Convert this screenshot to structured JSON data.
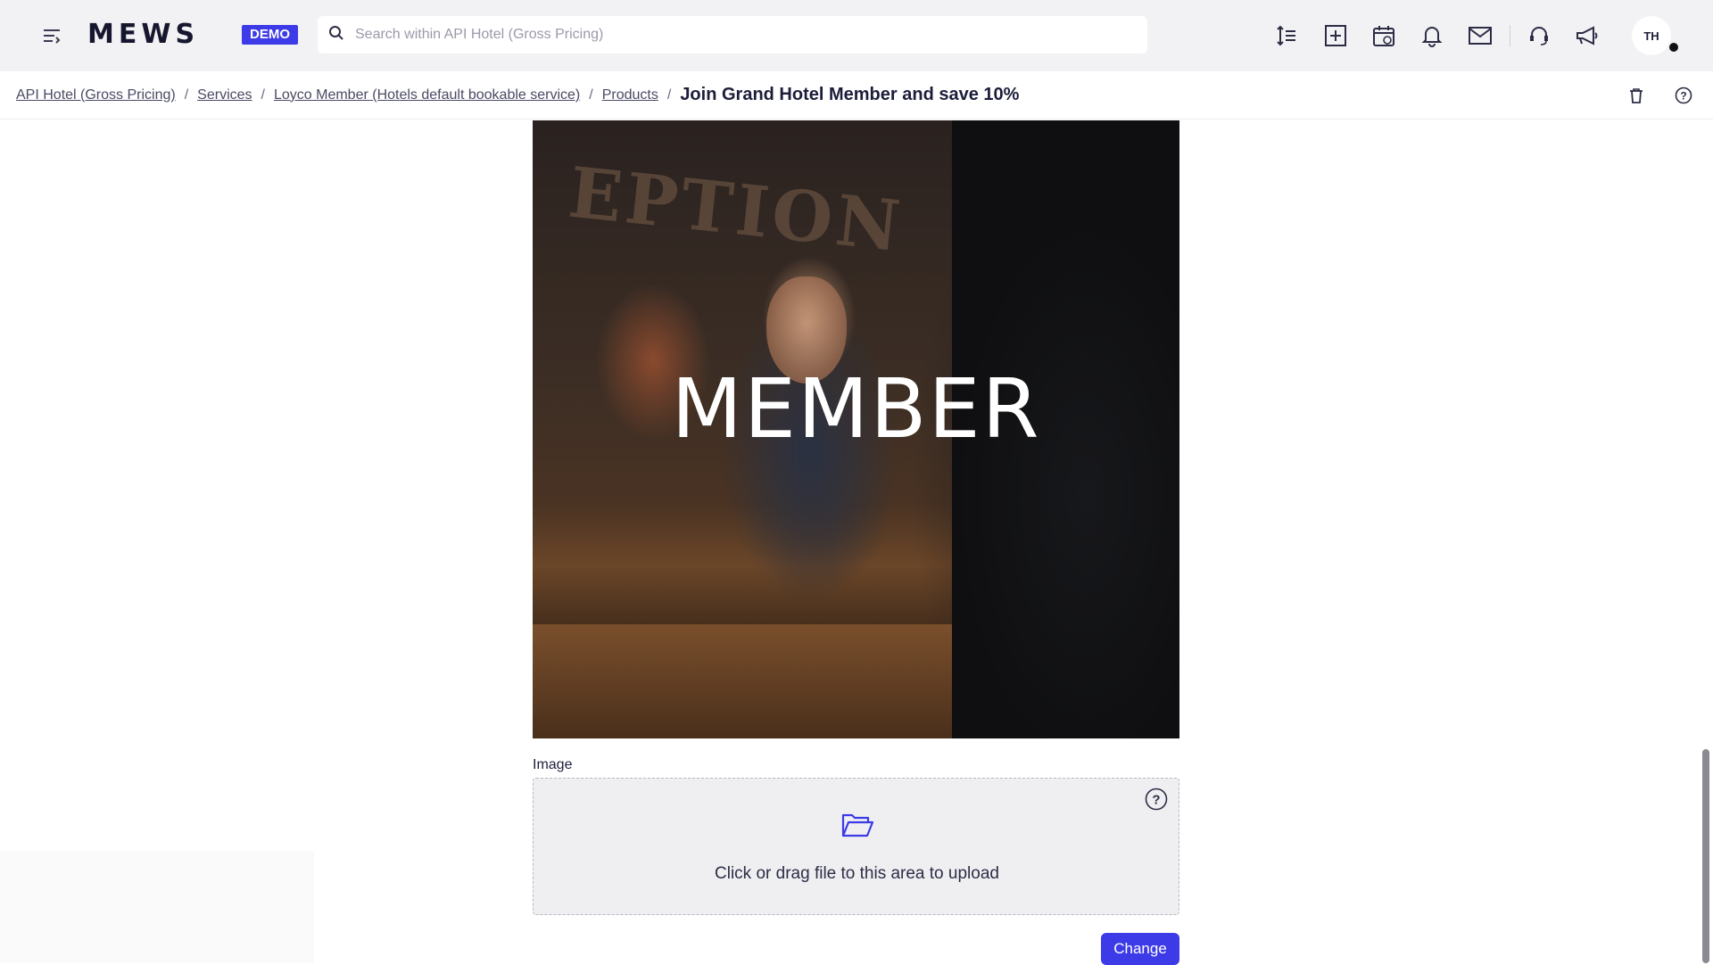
{
  "header": {
    "logo": "MEWS",
    "badge": "DEMO",
    "search_placeholder": "Search within API Hotel (Gross Pricing)",
    "icons": [
      "menu-icon",
      "sort-icon",
      "add-icon",
      "calendar-icon",
      "bell-icon",
      "mail-icon",
      "support-icon",
      "megaphone-icon"
    ],
    "avatar_initials": "TH"
  },
  "breadcrumb": {
    "items": [
      "API Hotel (Gross Pricing)",
      "Services",
      "Loyco Member (Hotels default bookable service)",
      "Products"
    ],
    "separator": "/",
    "current": "Join Grand Hotel Member and save 10%"
  },
  "content": {
    "hero_title": "MEMBER",
    "hero_sign": "EPTION",
    "image_label": "Image",
    "upload_text": "Click or drag file to this area to upload",
    "change_button": "Change"
  },
  "colors": {
    "accent": "#3d3ae8",
    "topbar": "#f2f2f4",
    "text": "#1c1d3a"
  }
}
